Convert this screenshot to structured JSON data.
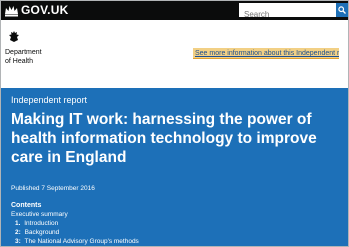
{
  "header": {
    "logo_text": "GOV.UK",
    "search_placeholder": "Search"
  },
  "organisation": {
    "name_line1": "Department",
    "name_line2": "of Health",
    "more_info_link": "See more information about this Independent report"
  },
  "banner": {
    "report_type": "Independent report",
    "title": "Making IT work: harnessing the power of health information technology to improve care in England",
    "published": "Published 7 September 2016"
  },
  "contents": {
    "heading": "Contents",
    "items": [
      {
        "num": "",
        "label": "Executive summary"
      },
      {
        "num": "1.",
        "label": "Introduction"
      },
      {
        "num": "2:",
        "label": "Background"
      },
      {
        "num": "3:",
        "label": "The National Advisory Group's methods"
      }
    ]
  },
  "colors": {
    "header_bg": "#0b0c0c",
    "banner_bg": "#1d70b8",
    "more_info_bg": "#f2d085"
  }
}
